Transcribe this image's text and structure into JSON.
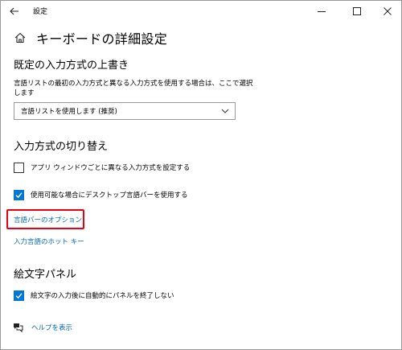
{
  "window": {
    "title": "設定"
  },
  "header": {
    "title": "キーボードの詳細設定"
  },
  "input_override": {
    "title": "既定の入力方式の上書き",
    "description": "言語リストの最初の入力方式と異なる入力方式を使用する場合は、ここで選択します",
    "select_value": "言語リストを使用します (推奨)"
  },
  "switching": {
    "title": "入力方式の切り替え",
    "option1": {
      "label": "アプリ ウィンドウごとに異なる入力方式を設定する",
      "checked": false
    },
    "option2": {
      "label": "使用可能な場合にデスクトップ言語バーを使用する",
      "checked": true
    },
    "langbar_options_link": "言語バーのオプション",
    "hotkeys_link": "入力言語のホット キー"
  },
  "emoji_panel": {
    "title": "絵文字パネル",
    "option": {
      "label": "絵文字の入力後に自動的にパネルを終了しない",
      "checked": true
    }
  },
  "help": {
    "label": "ヘルプを表示"
  },
  "colors": {
    "accent": "#0078d7",
    "link": "#0067c0",
    "highlight": "#e60012"
  }
}
